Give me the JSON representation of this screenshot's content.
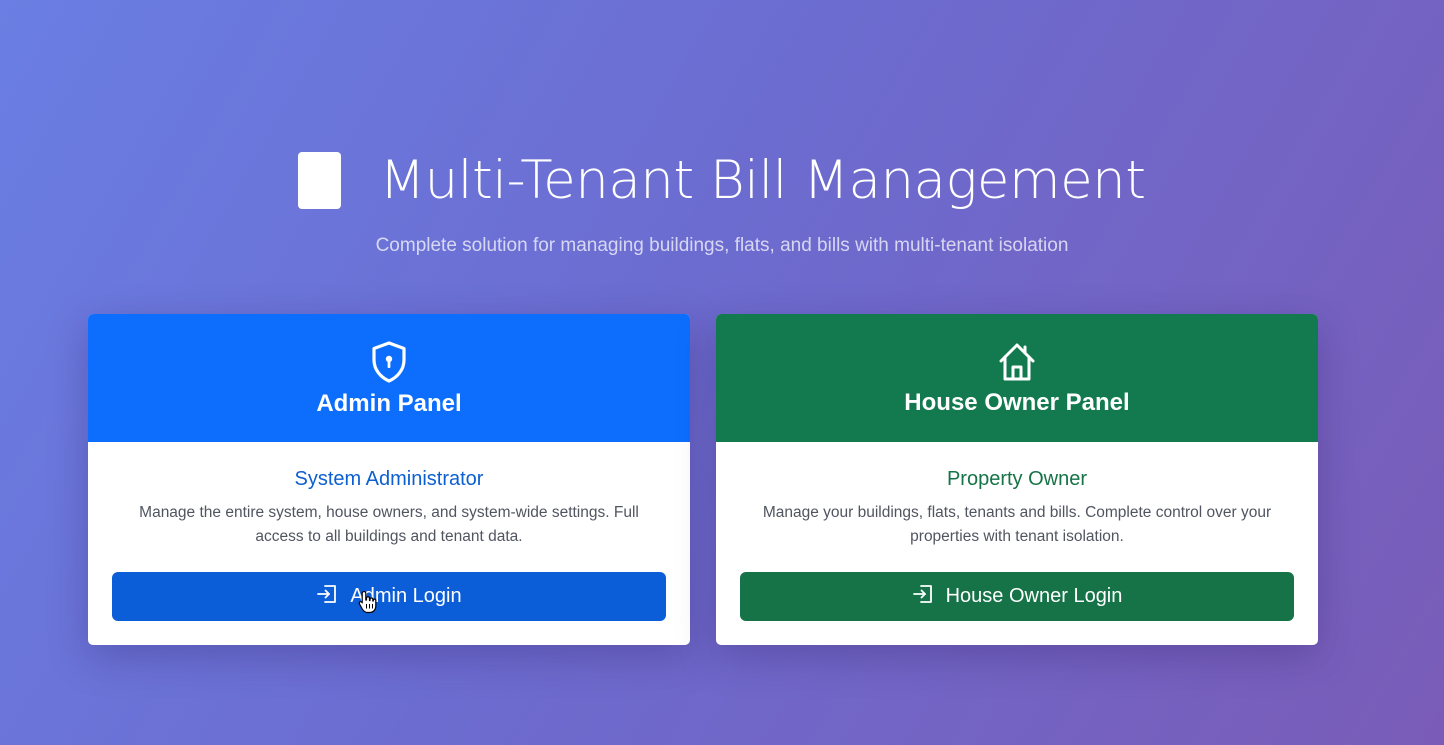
{
  "hero": {
    "title": "Multi-Tenant Bill Management",
    "subtitle": "Complete solution for managing buildings, flats, and bills with multi-tenant isolation"
  },
  "cards": [
    {
      "id": "admin",
      "header_title": "Admin Panel",
      "header_icon": "shield-lock-icon",
      "role": "System Administrator",
      "description": "Manage the entire system, house owners, and system-wide settings. Full access to all buildings and tenant data.",
      "button_label": "Admin Login",
      "button_icon": "login-icon",
      "color": "#0d6efd"
    },
    {
      "id": "owner",
      "header_title": "House Owner Panel",
      "header_icon": "house-icon",
      "role": "Property Owner",
      "description": "Manage your buildings, flats, tenants and bills. Complete control over your properties with tenant isolation.",
      "button_label": "House Owner Login",
      "button_icon": "login-icon",
      "color": "#137a50"
    }
  ],
  "colors": {
    "background_start": "#6a7ee3",
    "background_end": "#7a5cb8",
    "admin": "#0d6efd",
    "owner": "#137a50"
  }
}
